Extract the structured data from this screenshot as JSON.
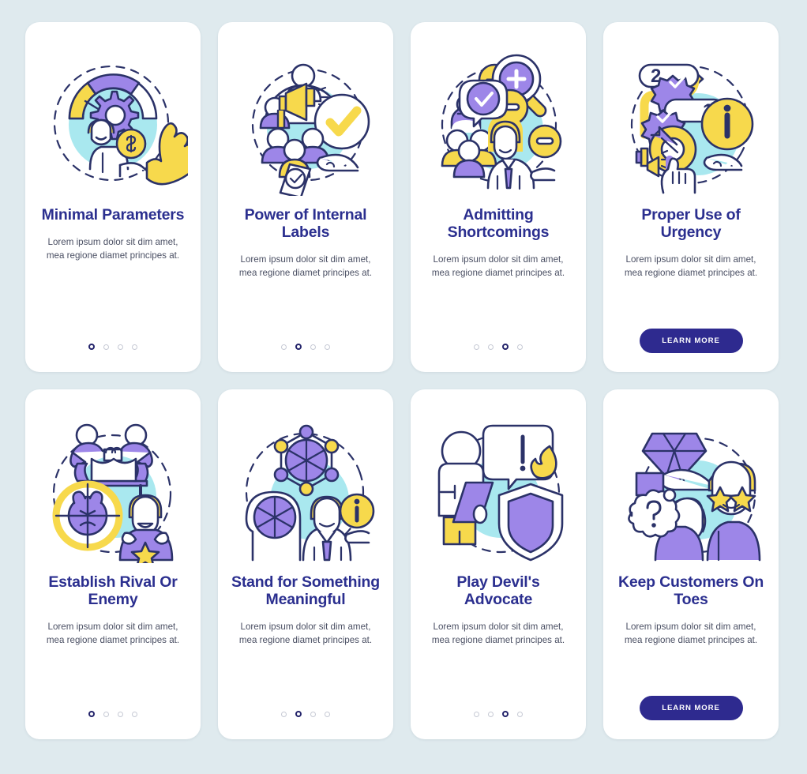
{
  "theme": {
    "page_background": "#dfeaee",
    "card_background": "#ffffff",
    "title_color": "#2b2f8f",
    "body_text_color": "#4a4f63",
    "accent_purple": "#9d86e8",
    "accent_yellow": "#f7d94c",
    "accent_cyan": "#a9e8ef",
    "stroke_color": "#2b3268",
    "button_color": "#2e2a8f",
    "dot_inactive": "#c6c9d4",
    "dot_active": "#24246b"
  },
  "common": {
    "body_text": "Lorem ipsum dolor sit dim amet, mea regione diamet principes at.",
    "learn_more_label": "LEARN MORE",
    "dot_count": 4
  },
  "cards": [
    {
      "id": "minimal-parameters",
      "title": "Minimal Parameters",
      "body": "Lorem ipsum dolor sit dim amet, mea regione diamet principes at.",
      "illustration": "gauge-gear-person-money-hand",
      "footer_type": "dots",
      "active_dot": 1,
      "dots": 4,
      "button_label": ""
    },
    {
      "id": "power-of-internal-labels",
      "title": "Power of Internal Labels",
      "body": "Lorem ipsum dolor sit dim amet, mea regione diamet principes at.",
      "illustration": "megaphone-team-checkmark-badge-hand",
      "footer_type": "dots",
      "active_dot": 2,
      "dots": 4,
      "button_label": ""
    },
    {
      "id": "admitting-shortcomings",
      "title": "Admitting Shortcomings",
      "body": "Lorem ipsum dolor sit dim amet, mea regione diamet principes at.",
      "illustration": "magnifier-plus-minus-team-businessman",
      "footer_type": "dots",
      "active_dot": 3,
      "dots": 4,
      "button_label": ""
    },
    {
      "id": "proper-use-of-urgency",
      "title": "Proper Use of Urgency",
      "body": "Lorem ipsum dolor sit dim amet, mea regione diamet principes at.",
      "illustration": "priority-list-info-target-hand-megaphone",
      "footer_type": "button",
      "active_dot": 0,
      "dots": 0,
      "button_label": "LEARN MORE"
    },
    {
      "id": "establish-rival-or-enemy",
      "title": "Establish Rival Or Enemy",
      "body": "Lorem ipsum dolor sit dim amet, mea regione diamet principes at.",
      "illustration": "arm-wrestle-target-angry-face-winner",
      "footer_type": "dots",
      "active_dot": 1,
      "dots": 4,
      "button_label": ""
    },
    {
      "id": "stand-for-something-meaningful",
      "title": "Stand for Something Meaningful",
      "body": "Lorem ipsum dolor sit dim amet, mea regione diamet principes at.",
      "illustration": "network-values-head-businessman-info",
      "footer_type": "dots",
      "active_dot": 2,
      "dots": 4,
      "button_label": ""
    },
    {
      "id": "play-devils-advocate",
      "title": "Play Devil's Advocate",
      "body": "Lorem ipsum dolor sit dim amet, mea regione diamet principes at.",
      "illustration": "person-speech-exclamation-flame-shield",
      "footer_type": "dots",
      "active_dot": 3,
      "dots": 4,
      "button_label": ""
    },
    {
      "id": "keep-customers-on-toes",
      "title": "Keep Customers On Toes",
      "body": "Lorem ipsum dolor sit dim amet, mea regione diamet principes at.",
      "illustration": "diamond-hand-star-eyes-question-customers",
      "footer_type": "button",
      "active_dot": 0,
      "dots": 0,
      "button_label": "LEARN MORE"
    }
  ]
}
